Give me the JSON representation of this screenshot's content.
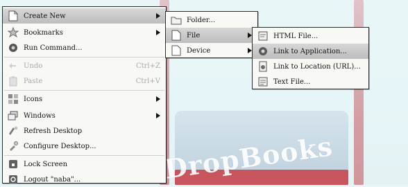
{
  "wallpaper": {
    "logo_text": "DropBooks",
    "accent_red": "#c9474f",
    "background": "#e6f5f7"
  },
  "main_menu": {
    "items": [
      {
        "label": "Create New",
        "icon": "blank-page-icon",
        "submenu": true,
        "selected": true
      },
      {
        "label": "Bookmarks",
        "icon": "star-icon",
        "submenu": true
      },
      {
        "label": "Run Command...",
        "icon": "run-gear-icon"
      },
      {
        "label": "Undo",
        "shortcut": "Ctrl+Z",
        "icon": "undo-arrow-icon",
        "disabled": true
      },
      {
        "label": "Paste",
        "shortcut": "Ctrl+V",
        "icon": "clipboard-icon",
        "disabled": true
      },
      {
        "label": "Icons",
        "icon": "icons-grid-icon",
        "submenu": true
      },
      {
        "label": "Windows",
        "icon": "windows-stack-icon",
        "submenu": true
      },
      {
        "label": "Refresh Desktop",
        "icon": "refresh-brush-icon"
      },
      {
        "label": "Configure Desktop...",
        "icon": "wrench-icon"
      },
      {
        "label": "Lock Screen",
        "icon": "lock-icon"
      },
      {
        "label": "Logout \"naba\"...",
        "icon": "power-icon"
      }
    ]
  },
  "create_new_menu": {
    "items": [
      {
        "label": "Folder...",
        "icon": "folder-icon"
      },
      {
        "label": "File",
        "icon": "file-icon",
        "submenu": true,
        "selected": true
      },
      {
        "label": "Device",
        "icon": "device-icon",
        "submenu": true
      }
    ]
  },
  "file_menu": {
    "items": [
      {
        "label": "HTML File...",
        "icon": "html-file-icon"
      },
      {
        "label": "Link to Application...",
        "icon": "link-app-icon",
        "selected": true
      },
      {
        "label": "Link to Location (URL)...",
        "icon": "globe-link-icon"
      },
      {
        "label": "Text File...",
        "icon": "text-file-icon"
      }
    ]
  }
}
